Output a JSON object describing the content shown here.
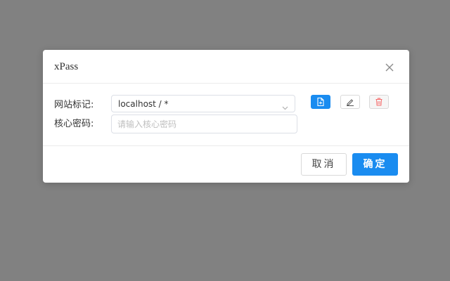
{
  "dialog": {
    "title": "xPass"
  },
  "form": {
    "site_label": "网站标记:",
    "site_selected": "localhost / *",
    "password_label": "核心密码:",
    "password_placeholder": "请输入核心密码"
  },
  "actions": {
    "new_icon": "file-add-icon",
    "edit_icon": "pencil-icon",
    "delete_icon": "trash-icon"
  },
  "footer": {
    "cancel_label": "取消",
    "ok_label": "确定"
  },
  "colors": {
    "overlay": "#818181",
    "primary": "#1a8cf0",
    "danger": "#f56c6c",
    "border": "#dcdfe6"
  }
}
